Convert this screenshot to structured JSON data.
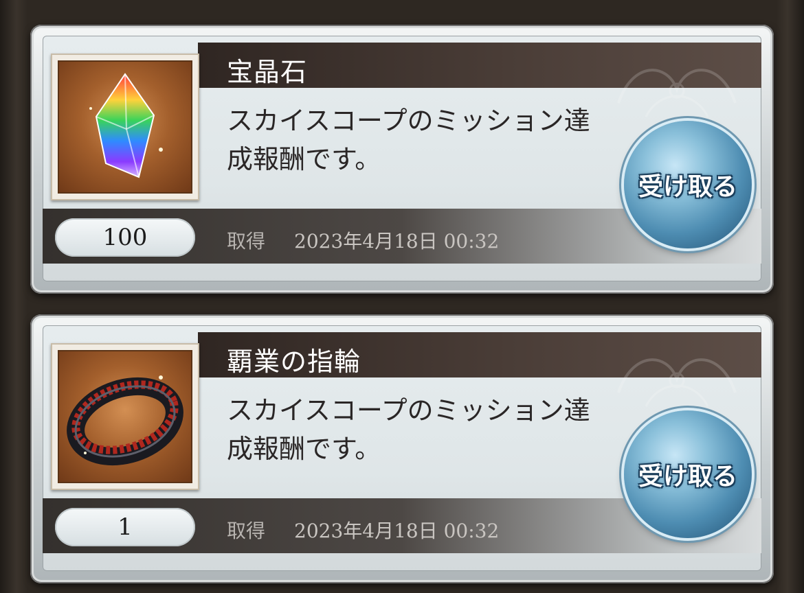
{
  "rewards": [
    {
      "name": "宝晶石",
      "description": "スカイスコープのミッション達成報酬です。",
      "count": "100",
      "acquired_label": "取得",
      "acquired_date": "2023年4月18日 00:32",
      "receive_label": "受け取る",
      "icon": "crystal-icon"
    },
    {
      "name": "覇業の指輪",
      "description": "スカイスコープのミッション達成報酬です。",
      "count": "1",
      "acquired_label": "取得",
      "acquired_date": "2023年4月18日 00:32",
      "receive_label": "受け取る",
      "icon": "ring-icon"
    }
  ],
  "colors": {
    "title_bar": "#3a2f2a",
    "receive_button": "#5a9cc4",
    "background": "#2b2621"
  }
}
